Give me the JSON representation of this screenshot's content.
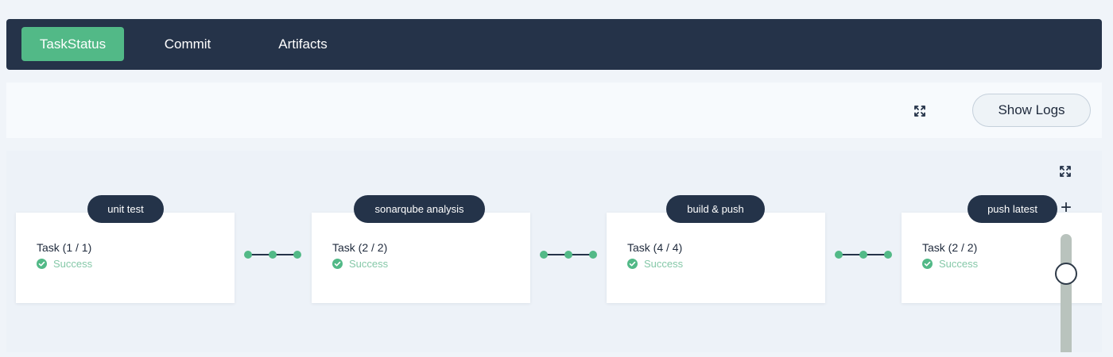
{
  "nav": {
    "tabs": [
      {
        "label": "TaskStatus",
        "active": true
      },
      {
        "label": "Commit",
        "active": false
      },
      {
        "label": "Artifacts",
        "active": false
      }
    ]
  },
  "toolbar": {
    "fullscreen_icon": "expand-icon",
    "show_logs_label": "Show Logs"
  },
  "pipeline": {
    "stages": [
      {
        "name": "unit test",
        "task": "Task (1 / 1)",
        "status": "Success"
      },
      {
        "name": "sonarqube analysis",
        "task": "Task (2 / 2)",
        "status": "Success"
      },
      {
        "name": "build & push",
        "task": "Task (4 / 4)",
        "status": "Success"
      },
      {
        "name": "push latest",
        "task": "Task (2 / 2)",
        "status": "Success"
      }
    ],
    "zoom_in_label": "+",
    "zoom_level": 0.75
  },
  "colors": {
    "nav_bg": "#253349",
    "accent_green": "#52b987",
    "pill_bg": "#243349",
    "success_text": "#85c8a8"
  }
}
